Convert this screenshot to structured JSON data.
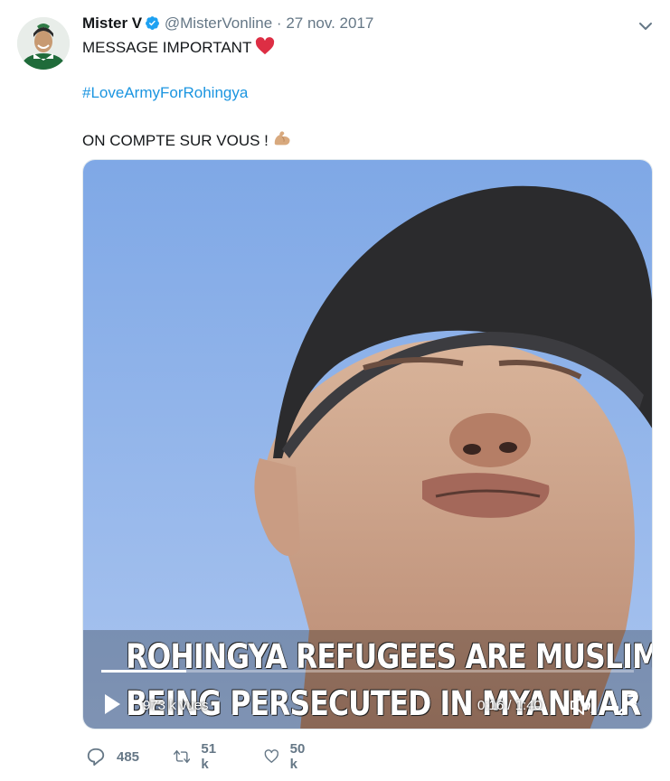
{
  "tweet": {
    "display_name": "Mister V",
    "handle": "@MisterVonline",
    "separator": "·",
    "date": "27 nov. 2017",
    "line1": "MESSAGE IMPORTANT",
    "hashtag": "#LoveArmyForRohingya",
    "line3": "ON COMPTE SUR VOUS !"
  },
  "video": {
    "caption_line1": "ROHINGYA REFUGEES ARE MUSLIMS WHO ARE",
    "caption_line2": "BEING PERSECUTED IN MYANMAR",
    "views": "973 k vues",
    "time": "0:16 / 1:40",
    "progress": 0.16
  },
  "actions": {
    "reply_count": "485",
    "retweet_count": "51 k",
    "like_count": "50 k"
  },
  "icons": {
    "verified": "verified-badge-icon",
    "heart_emoji": "red-heart-icon",
    "bicep_emoji": "flexed-biceps-icon",
    "caret": "chevron-down-icon",
    "play": "play-icon",
    "volume": "volume-icon",
    "fullscreen": "fullscreen-icon",
    "reply": "reply-icon",
    "retweet": "retweet-icon",
    "like": "like-icon"
  },
  "colors": {
    "link": "#1b95e0",
    "verified": "#1da1f2",
    "muted": "#657786",
    "heart": "#e0245e"
  }
}
